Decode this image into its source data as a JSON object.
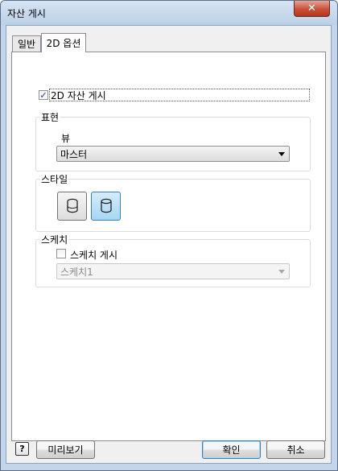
{
  "window": {
    "title": "자산 게시",
    "close_label": "✕"
  },
  "tabs": [
    {
      "label": "일반",
      "active": false
    },
    {
      "label": "2D 옵션",
      "active": true
    }
  ],
  "publish_2d": {
    "label": "2D 자산 게시",
    "checked": true
  },
  "representation": {
    "group_label": "표현",
    "view_label": "뷰",
    "view_value": "마스터"
  },
  "style": {
    "group_label": "스타일",
    "options": [
      {
        "icon": "cylinder-shaded-icon",
        "selected": false
      },
      {
        "icon": "cylinder-outline-icon",
        "selected": true
      }
    ]
  },
  "sketch": {
    "group_label": "스케치",
    "publish_label": "스케치 게시",
    "publish_checked": false,
    "sketch_value": "스케치1"
  },
  "footer": {
    "help_label": "?",
    "preview_label": "미리보기",
    "ok_label": "확인",
    "cancel_label": "취소"
  }
}
